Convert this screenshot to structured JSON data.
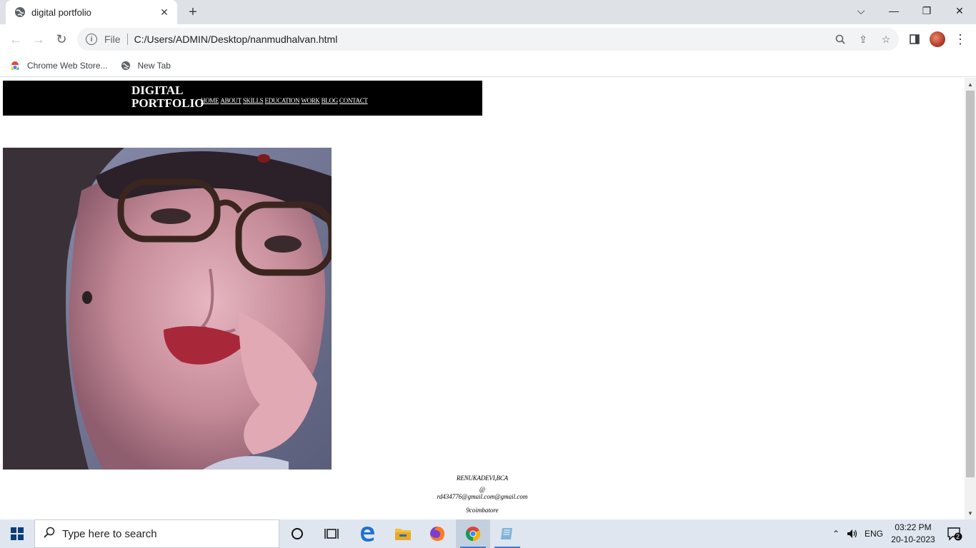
{
  "browser": {
    "tab_title": "digital portfolio",
    "new_tab_symbol": "+",
    "scheme_label": "File",
    "url": "C:/Users/ADMIN/Desktop/nanmudhalvan.html",
    "bookmarks": [
      {
        "label": "Chrome Web Store...",
        "icon": "chrome-web-store-icon"
      },
      {
        "label": "New Tab",
        "icon": "globe-icon"
      }
    ]
  },
  "page": {
    "logo_line1": "DIGITAL",
    "logo_line2": "PORTFOLIO",
    "nav": [
      "HOME",
      "ABOUT",
      "SKILLS",
      "EDUCATION",
      "WORK",
      "BLOG",
      "CONTACT"
    ],
    "footer": {
      "name": "RENUKADEVI,BCA",
      "at_symbol": "@",
      "email": "rd434776@gmail.com@gmail.com",
      "location": "9coimbatore"
    }
  },
  "taskbar": {
    "search_placeholder": "Type here to search",
    "language": "ENG",
    "time": "03:22 PM",
    "date": "20-10-2023",
    "notification_count": "2"
  }
}
